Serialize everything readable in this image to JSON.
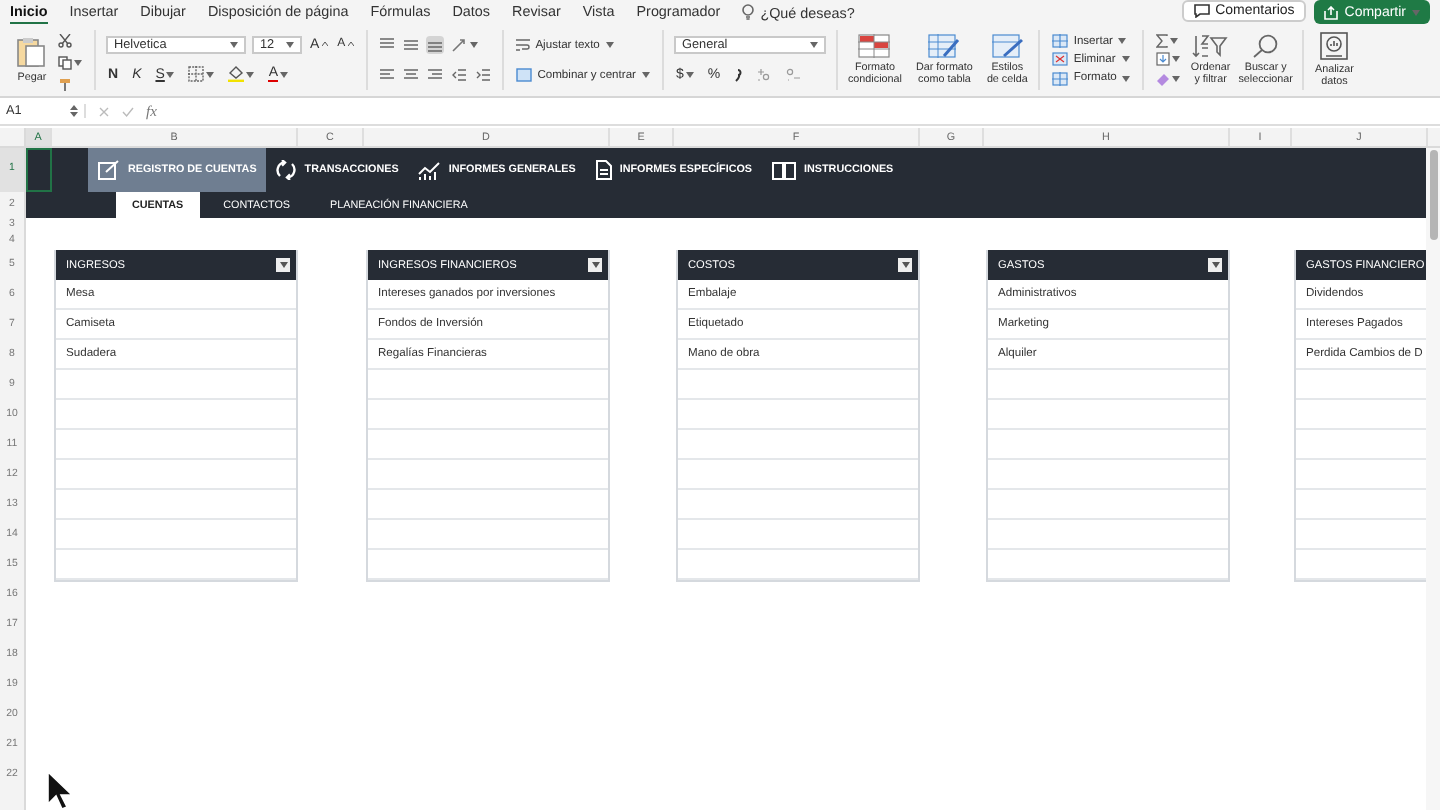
{
  "menu_tabs": [
    {
      "label": "Inicio",
      "selected": true
    },
    {
      "label": "Insertar",
      "selected": false
    },
    {
      "label": "Dibujar",
      "selected": false
    },
    {
      "label": "Disposición de página",
      "selected": false
    },
    {
      "label": "Fórmulas",
      "selected": false
    },
    {
      "label": "Datos",
      "selected": false
    },
    {
      "label": "Revisar",
      "selected": false
    },
    {
      "label": "Vista",
      "selected": false
    },
    {
      "label": "Programador",
      "selected": false
    }
  ],
  "tell_me": "¿Qué deseas?",
  "header_buttons": {
    "comments": "Comentarios",
    "share": "Compartir"
  },
  "ribbon": {
    "paste": "Pegar",
    "font": {
      "name": "Helvetica",
      "size": "12",
      "grow": "A",
      "shrink": "A",
      "bold": "N",
      "italic": "K",
      "underline": "S",
      "color_letter": "A"
    },
    "vertical_align": [
      {
        "selected": false
      },
      {
        "selected": false
      },
      {
        "selected": true
      }
    ],
    "wrap_text": "Ajustar texto",
    "merge_center": "Combinar y centrar",
    "number": {
      "format": "General",
      "currency": "$",
      "percent": "%"
    },
    "styles": [
      "Formato\ncondicional",
      "Dar formato\ncomo tabla",
      "Estilos\nde celda"
    ],
    "cells": [
      "Insertar",
      "Eliminar",
      "Formato"
    ],
    "editing": [
      "Ordenar\ny filtrar",
      "Buscar y\nseleccionar"
    ],
    "analyze": "Analizar\ndatos"
  },
  "formula_bar": {
    "name_box": "A1",
    "function_label": "fx"
  },
  "columns": [
    "A",
    "B",
    "C",
    "D",
    "E",
    "F",
    "G",
    "H",
    "I",
    "J"
  ],
  "rows": [
    "1",
    "2",
    "3",
    "4",
    "5",
    "6",
    "7",
    "8",
    "9",
    "10",
    "11",
    "12",
    "13",
    "14",
    "15",
    "16",
    "17",
    "18",
    "19",
    "20",
    "21",
    "22"
  ],
  "nav": [
    {
      "label": "REGISTRO DE CUENTAS",
      "selected": true
    },
    {
      "label": "TRANSACCIONES",
      "selected": false
    },
    {
      "label": "INFORMES GENERALES",
      "selected": false
    },
    {
      "label": "INFORMES ESPECÍFICOS",
      "selected": false
    },
    {
      "label": "INSTRUCCIONES",
      "selected": false
    }
  ],
  "subtabs": [
    {
      "label": "CUENTAS",
      "selected": true
    },
    {
      "label": "CONTACTOS",
      "selected": false
    },
    {
      "label": "PLANEACIÓN FINANCIERA",
      "selected": false
    }
  ],
  "lists": [
    {
      "title": "INGRESOS",
      "filter_button": true,
      "items": [
        "Mesa",
        "Camiseta",
        "Sudadera"
      ]
    },
    {
      "title": "INGRESOS FINANCIEROS",
      "filter_button": true,
      "items": [
        "Intereses ganados por inversiones",
        "Fondos de Inversión",
        "Regalías Financieras"
      ]
    },
    {
      "title": "COSTOS",
      "filter_button": true,
      "items": [
        "Embalaje",
        "Etiquetado",
        "Mano de obra"
      ]
    },
    {
      "title": "GASTOS",
      "filter_button": true,
      "items": [
        "Administrativos",
        "Marketing",
        "Alquiler"
      ]
    },
    {
      "title": "GASTOS FINANCIERO",
      "filter_button": false,
      "items": [
        "Dividendos",
        "Intereses Pagados",
        "Perdida Cambios de D"
      ]
    }
  ]
}
